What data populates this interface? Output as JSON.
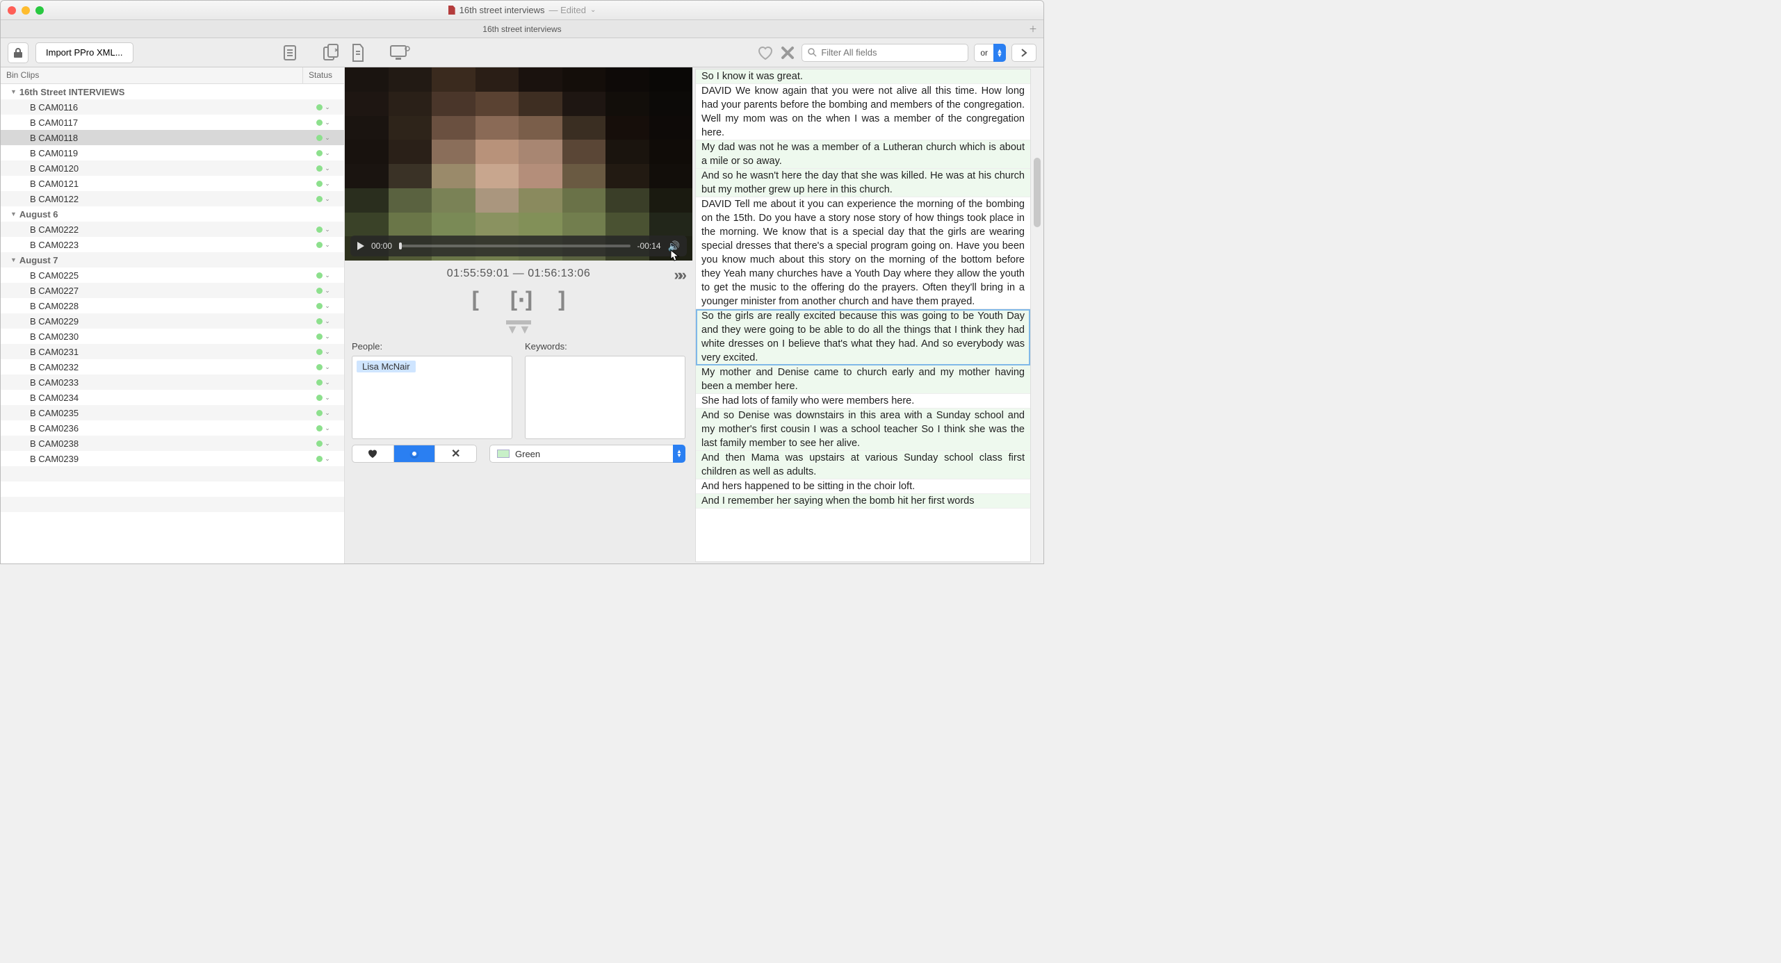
{
  "window": {
    "title": "16th street interviews",
    "edited_suffix": "— Edited",
    "tab_title": "16th street interviews"
  },
  "toolbar": {
    "import_label": "Import PPro XML...",
    "search_placeholder": "Filter All fields",
    "or_label": "or"
  },
  "bin": {
    "header_col1": "Bin Clips",
    "header_col2": "Status",
    "groups": [
      {
        "label": "16th Street INTERVIEWS",
        "clips": [
          "B CAM0116",
          "B CAM0117",
          "B CAM0118",
          "B CAM0119",
          "B CAM0120",
          "B CAM0121",
          "B CAM0122"
        ]
      },
      {
        "label": "August 6",
        "clips": [
          "B CAM0222",
          "B CAM0223"
        ]
      },
      {
        "label": "August 7",
        "clips": [
          "B CAM0225",
          "B CAM0227",
          "B CAM0228",
          "B CAM0229",
          "B CAM0230",
          "B CAM0231",
          "B CAM0232",
          "B CAM0233",
          "B CAM0234",
          "B CAM0235",
          "B CAM0236",
          "B CAM0238",
          "B CAM0239"
        ]
      }
    ],
    "selected": "B CAM0118"
  },
  "player": {
    "current_time": "00:00",
    "remaining": "-00:14",
    "tc_in": "01:55:59:01",
    "tc_out": "01:56:13:06",
    "tc_sep": "—"
  },
  "meta": {
    "people_label": "People:",
    "keywords_label": "Keywords:",
    "people": [
      "Lisa McNair"
    ],
    "color_label": "Green"
  },
  "transcript": [
    {
      "text": "So I know it was great.",
      "color": "green"
    },
    {
      "text": "DAVID We know again that you were not alive all this time. How long had your parents before the bombing and members of the congregation. Well my mom was on the when I was a member of the congregation here.",
      "color": ""
    },
    {
      "text": "My dad was not he was a member of a Lutheran church which is about a mile or so away.",
      "color": "green"
    },
    {
      "text": "And so he wasn't here the day that she was killed. He was at his church but my mother grew up here in this church.",
      "color": "green"
    },
    {
      "text": "DAVID Tell me about it you can experience the morning of the bombing on the 15th. Do you have a story nose story of how things took place in the morning. We know that is a special day that the girls are wearing special dresses that there's a special program going on. Have you been you know much about this story on the morning of the bottom before they Yeah many churches have a Youth Day where they allow the youth to get the music to the offering do the prayers. Often they'll bring in a younger minister from another church and have them prayed.",
      "color": ""
    },
    {
      "text": "So the girls are really excited because this was going to be Youth Day and they were going to be able to do all the things that I think they had white dresses on I believe that's what they had. And so everybody was very excited.",
      "color": "sel"
    },
    {
      "text": "My mother and Denise came to church early and my mother having been a member here.",
      "color": "green"
    },
    {
      "text": "She had lots of family who were members here.",
      "color": ""
    },
    {
      "text": "And so Denise was downstairs in this area with a Sunday school and my mother's first cousin I was a school teacher So I think she was the last family member to see her alive.",
      "color": "green"
    },
    {
      "text": "And then Mama was upstairs at various Sunday school class first children as well as adults.",
      "color": "green"
    },
    {
      "text": "And hers happened to be sitting in the choir loft.",
      "color": ""
    },
    {
      "text": "And I remember her saying when the bomb hit her first words",
      "color": "green"
    }
  ]
}
